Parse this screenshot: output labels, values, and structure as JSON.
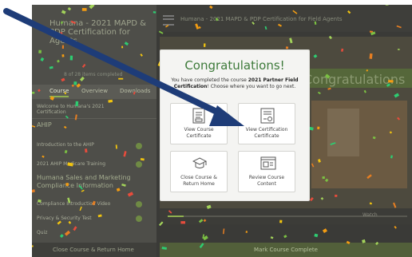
{
  "app": {
    "sidebar_title": "Humana - 2021 MAPD & PDP Certification for Agents",
    "progress_text": "8 of 28 items completed",
    "tabs": [
      "Course",
      "Overview",
      "Downloads"
    ],
    "items": [
      {
        "label": "Welcome to Humana's 2021 Certification"
      },
      {
        "label": "Introduction to the AHIP"
      },
      {
        "label": "2021 AHIP Medicare Training"
      }
    ],
    "section_ahip": "AHIP",
    "section_humana": "Humana Sales and Marketing Compliance Information",
    "lower_items": [
      {
        "label": "Compliance Introduction Video"
      },
      {
        "label": "Privacy & Security Test"
      },
      {
        "label": "Quiz"
      }
    ],
    "close_course": "Close Course & Return Home",
    "breadcrumb": "Humana - 2021 MAPD & PDP Certification for Field Agents",
    "video_banner": "Congratulations",
    "caption_label": "Watch",
    "mark_complete": "Mark Course Complete"
  },
  "modal": {
    "title": "Congratulations!",
    "body_prefix": "You have completed the course",
    "course_name": "2021 Partner Field Certification",
    "body_suffix": "! Choose where you want to go next.",
    "options": [
      {
        "label": "View Course\nCertificate",
        "icon": "certificate-document-icon"
      },
      {
        "label": "View Certification\nCertificate",
        "icon": "certificate-award-icon"
      },
      {
        "label": "Close Course &\nReturn Home",
        "icon": "graduation-cap-icon"
      },
      {
        "label": "Review Course\nContent",
        "icon": "browser-content-icon"
      }
    ]
  },
  "colors": {
    "accent": "#3d7a3a",
    "arrow": "#1e3c78",
    "confetti": [
      "#7bc043",
      "#f1c40f",
      "#e67e22",
      "#2ecc71",
      "#f39c12",
      "#a3d35a",
      "#e74c3c"
    ]
  }
}
